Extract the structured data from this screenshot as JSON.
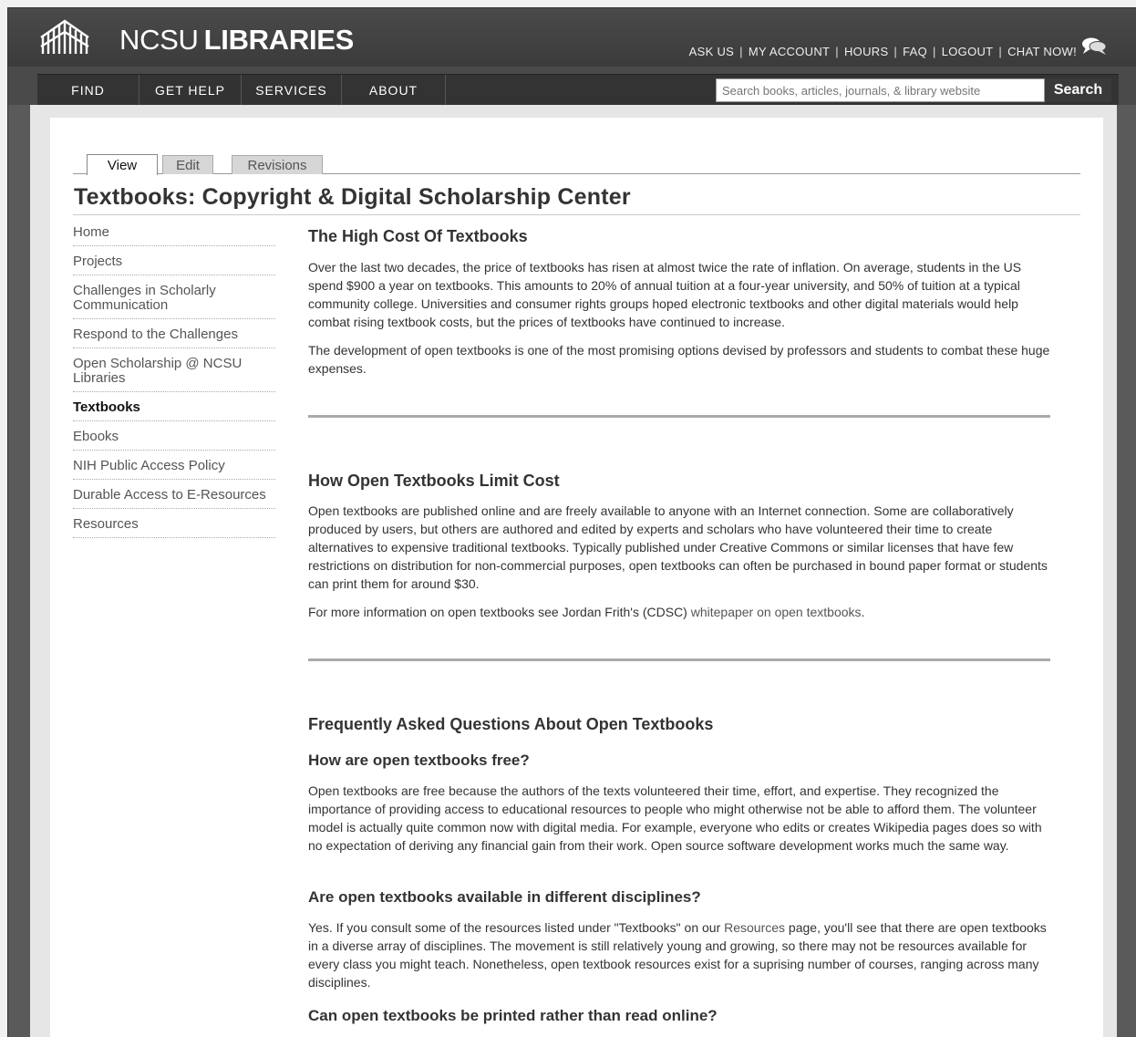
{
  "header": {
    "logo_text_light": "NCSU",
    "logo_text_bold": "LIBRARIES",
    "utility_links": [
      "ASK US",
      "MY ACCOUNT",
      "HOURS",
      "FAQ",
      "LOGOUT",
      "CHAT NOW!"
    ],
    "chat_icon": "chat-bubble-icon"
  },
  "nav": {
    "items": [
      "FIND",
      "GET HELP",
      "SERVICES",
      "ABOUT"
    ],
    "search_placeholder": "Search books, articles, journals, & library website",
    "search_button": "Search"
  },
  "tabs": [
    "View",
    "Edit",
    "Revisions"
  ],
  "active_tab": "View",
  "page_title": "Textbooks: Copyright & Digital Scholarship Center",
  "sidebar": {
    "items": [
      "Home",
      "Projects",
      "Challenges in Scholarly Communication",
      "Respond to the Challenges",
      "Open Scholarship @ NCSU Libraries",
      "Textbooks",
      "Ebooks",
      "NIH Public Access Policy",
      "Durable Access to E-Resources",
      "Resources"
    ],
    "active": "Textbooks"
  },
  "sections": {
    "high_cost": {
      "heading": "The High Cost Of Textbooks",
      "p1": "Over the last two decades, the price of textbooks has risen at almost twice the rate of inflation. On average, students in the US spend $900 a year on textbooks. This amounts to 20% of annual tuition at a four-year university, and 50% of tuition at a typical community college. Universities and consumer rights groups hoped electronic textbooks and other digital materials would help combat rising textbook costs, but the prices of textbooks have continued to increase.",
      "p2": "The development of open textbooks is one of the most promising options devised by professors and students to combat these huge expenses."
    },
    "limit_cost": {
      "heading": "How Open Textbooks Limit Cost",
      "p1": "Open textbooks are published online and are freely available to anyone with an Internet connection. Some are collaboratively produced by users, but others are authored and edited by experts and scholars who have volunteered their time to create alternatives to expensive traditional textbooks. Typically published under Creative Commons or similar licenses that have few restrictions on distribution for non-commercial purposes, open textbooks can often be purchased in bound paper format or students can print them for around $30.",
      "p2_prefix": "For more information on open textbooks see Jordan Frith's (CDSC) ",
      "p2_link": "whitepaper on open textbooks",
      "p2_suffix": "."
    },
    "faq": {
      "heading": "Frequently Asked Questions About Open Textbooks",
      "q1": "How are open textbooks free?",
      "a1": "Open textbooks are free because the authors of the texts volunteered their time, effort, and expertise. They recognized the importance of providing access to educational resources to people who might otherwise not be able to afford them. The volunteer model is actually quite common now with digital media. For example, everyone who edits or creates Wikipedia pages does so with no expectation of deriving any financial gain from their work. Open source software development works much the same way.",
      "q2": "Are open textbooks available in different disciplines?",
      "a2_prefix": "Yes. If you consult some of the resources listed under \"Textbooks\" on our ",
      "a2_link": "Resources",
      "a2_suffix": " page, you'll see that there are open textbooks in a diverse array of disciplines. The movement is still relatively young and growing, so there may not be resources available for every class you might teach. Nonetheless, open textbook resources exist for a suprising number of courses, ranging across many disciplines.",
      "q3": "Can open textbooks be printed rather than read online?"
    }
  }
}
